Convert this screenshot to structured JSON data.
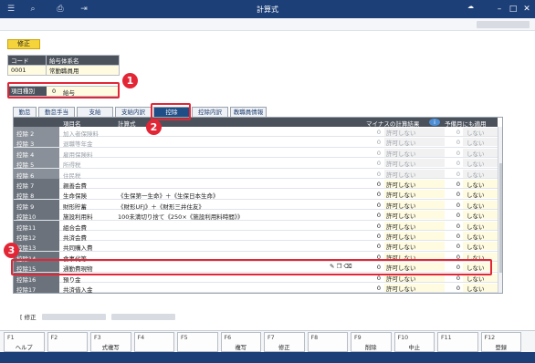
{
  "window": {
    "title": "計算式"
  },
  "mode_badge": "修正",
  "header": {
    "col_code": "コード",
    "col_name": "給与体系名",
    "code": "0001",
    "name": "常勤職員用"
  },
  "item_kind": {
    "label": "項目種別",
    "number": "0",
    "value": "給与"
  },
  "tabs": [
    "勤怠",
    "勤怠手当",
    "支給",
    "支給内訳",
    "控除",
    "控除内訳",
    "教職員情報"
  ],
  "columns": {
    "name": "項目名",
    "formula": "計算式",
    "result": "マイナスの計算結果",
    "advance": "予備月にも適用"
  },
  "rows": [
    {
      "code": "控除 2",
      "name": "加入者保険料",
      "formula": "",
      "n1": "0",
      "r1": "許可しない",
      "n2": "0",
      "r2": "しない",
      "disabled": true
    },
    {
      "code": "控除 3",
      "name": "退職等年金",
      "formula": "",
      "n1": "0",
      "r1": "許可しない",
      "n2": "0",
      "r2": "しない",
      "disabled": true
    },
    {
      "code": "控除 4",
      "name": "雇用保険料",
      "formula": "",
      "n1": "0",
      "r1": "許可しない",
      "n2": "0",
      "r2": "しない",
      "disabled": true
    },
    {
      "code": "控除 5",
      "name": "所得税",
      "formula": "",
      "n1": "0",
      "r1": "許可しない",
      "n2": "0",
      "r2": "しない",
      "disabled": true
    },
    {
      "code": "控除 6",
      "name": "住民税",
      "formula": "",
      "n1": "0",
      "r1": "許可しない",
      "n2": "0",
      "r2": "しない",
      "disabled": true
    },
    {
      "code": "控除 7",
      "name": "親善会費",
      "formula": "",
      "n1": "0",
      "r1": "許可しない",
      "n2": "0",
      "r2": "しない",
      "disabled": false
    },
    {
      "code": "控除 8",
      "name": "生命保険",
      "formula": "《生保第一生命》＋《生保日本生命》",
      "n1": "0",
      "r1": "許可しない",
      "n2": "0",
      "r2": "しない",
      "disabled": false
    },
    {
      "code": "控除 9",
      "name": "財形貯蓄",
      "formula": "《財形UFJ》＋《財形三井住友》",
      "n1": "0",
      "r1": "許可しない",
      "n2": "0",
      "r2": "しない",
      "disabled": false
    },
    {
      "code": "控除10",
      "name": "施設利用料",
      "formula": "100未満切り捨て《250×《施設利用料時間》》",
      "n1": "0",
      "r1": "許可しない",
      "n2": "0",
      "r2": "しない",
      "disabled": false
    },
    {
      "code": "控除11",
      "name": "組合会費",
      "formula": "",
      "n1": "0",
      "r1": "許可しない",
      "n2": "0",
      "r2": "しない",
      "disabled": false
    },
    {
      "code": "控除12",
      "name": "共済会費",
      "formula": "",
      "n1": "0",
      "r1": "許可しない",
      "n2": "0",
      "r2": "しない",
      "disabled": false
    },
    {
      "code": "控除13",
      "name": "共同購入費",
      "formula": "",
      "n1": "0",
      "r1": "許可しない",
      "n2": "0",
      "r2": "しない",
      "disabled": false
    },
    {
      "code": "控除14",
      "name": "食事代等",
      "formula": "",
      "n1": "0",
      "r1": "許可しない",
      "n2": "0",
      "r2": "しない",
      "disabled": false
    },
    {
      "code": "控除15",
      "name": "通勤費現物",
      "formula": "",
      "n1": "0",
      "r1": "許可しない",
      "n2": "0",
      "r2": "しない",
      "disabled": false
    },
    {
      "code": "控除16",
      "name": "預り金",
      "formula": "",
      "n1": "0",
      "r1": "許可しない",
      "n2": "0",
      "r2": "しない",
      "disabled": false
    },
    {
      "code": "控除17",
      "name": "共済借入金",
      "formula": "",
      "n1": "0",
      "r1": "許可しない",
      "n2": "0",
      "r2": "しない",
      "disabled": false
    }
  ],
  "status": {
    "label": "修正"
  },
  "fkeys": [
    {
      "key": "F1",
      "label": "ヘルプ"
    },
    {
      "key": "F2",
      "label": ""
    },
    {
      "key": "F3",
      "label": "式複写"
    },
    {
      "key": "F4",
      "label": ""
    },
    {
      "key": "F5",
      "label": ""
    },
    {
      "key": "F6",
      "label": "複写"
    },
    {
      "key": "F7",
      "label": "修正"
    },
    {
      "key": "F8",
      "label": ""
    },
    {
      "key": "F9",
      "label": "削除"
    },
    {
      "key": "F10",
      "label": "中止"
    },
    {
      "key": "F11",
      "label": ""
    },
    {
      "key": "F12",
      "label": "登録"
    }
  ],
  "callouts": [
    "1",
    "2",
    "3"
  ],
  "colors": {
    "titlebar": "#1d3f78",
    "annotation": "#e32636",
    "badge": "#f5d33a"
  }
}
